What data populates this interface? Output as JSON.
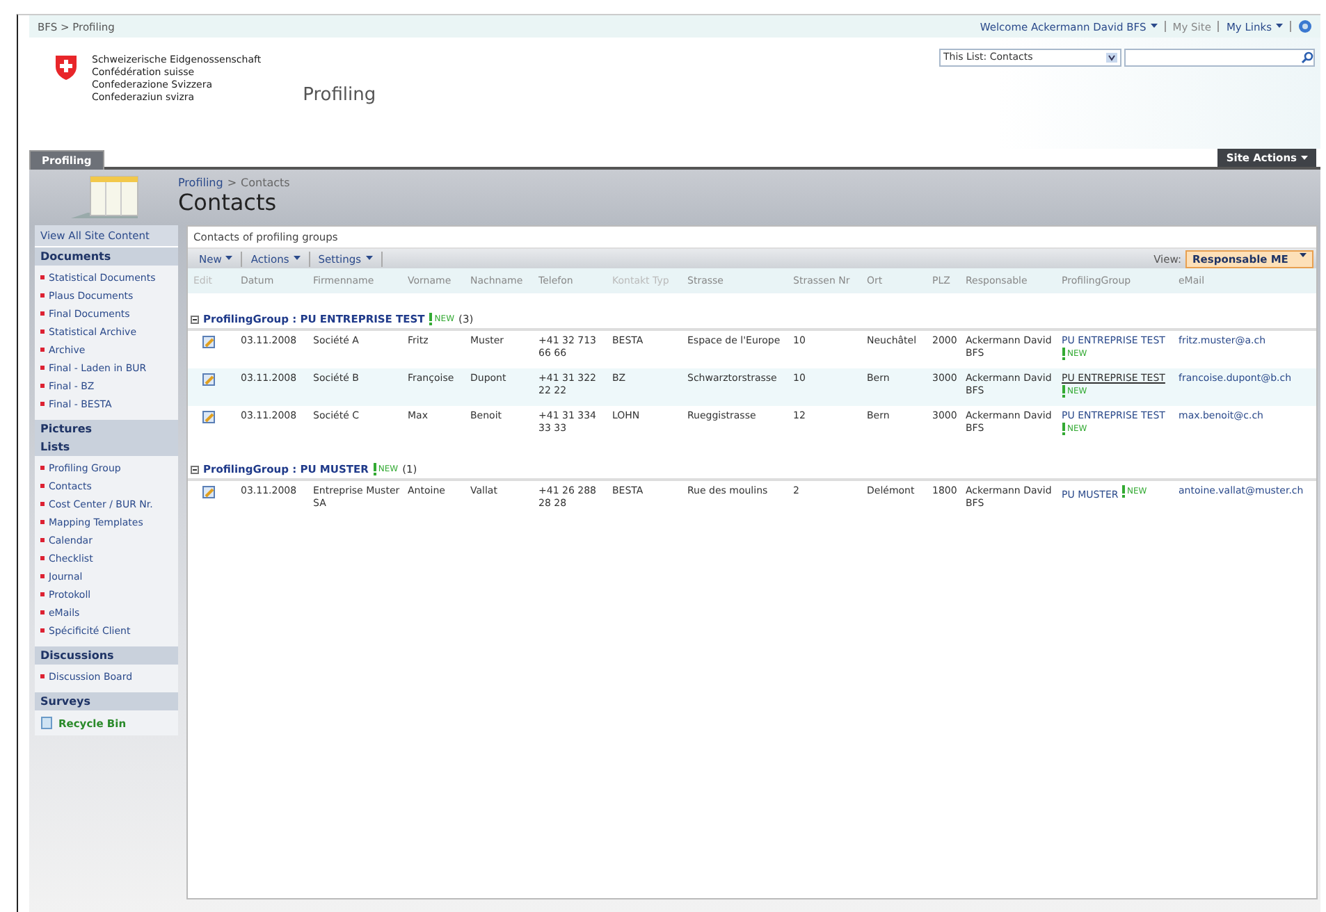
{
  "top_bar": {
    "breadcrumb": "BFS > Profiling",
    "welcome": "Welcome Ackermann David BFS",
    "my_site": "My Site",
    "my_links": "My Links"
  },
  "header": {
    "logo_lines": [
      "Schweizerische Eidgenossenschaft",
      "Confédération suisse",
      "Confederazione Svizzera",
      "Confederaziun svizra"
    ],
    "site_title": "Profiling",
    "search_scope": "This List: Contacts"
  },
  "tabs": [
    {
      "label": "Profiling",
      "selected": true
    }
  ],
  "site_actions": "Site Actions",
  "title_area": {
    "breadcrumb_link": "Profiling",
    "breadcrumb_sep": ">",
    "breadcrumb_current": "Contacts",
    "title": "Contacts"
  },
  "sidebar": {
    "view_all": "View All Site Content",
    "sections": [
      {
        "title": "Documents",
        "items": [
          "Statistical Documents",
          "Plaus Documents",
          "Final Documents",
          "Statistical Archive",
          "Archive",
          "Final - Laden in BUR",
          "Final - BZ",
          "Final - BESTA"
        ]
      },
      {
        "title": "Pictures"
      },
      {
        "title": "Lists",
        "items": [
          "Profiling Group",
          "Contacts",
          "Cost Center / BUR Nr.",
          "Mapping Templates",
          "Calendar",
          "Checklist",
          "Journal",
          "Protokoll",
          "eMails",
          "Spécificité Client"
        ]
      },
      {
        "title": "Discussions",
        "items": [
          "Discussion Board"
        ]
      },
      {
        "title": "Surveys"
      }
    ],
    "recycle_bin": "Recycle Bin"
  },
  "list": {
    "description": "Contacts of profiling groups",
    "toolbar": [
      "New",
      "Actions",
      "Settings"
    ],
    "view_label": "View:",
    "view": "Responsable ME",
    "columns": [
      "Edit",
      "Datum",
      "Firmenname",
      "Vorname",
      "Nachname",
      "Telefon",
      "Kontakt Typ",
      "Strasse",
      "Strassen Nr",
      "Ort",
      "PLZ",
      "Responsable",
      "ProfilingGroup",
      "eMail"
    ],
    "groups": [
      {
        "label": "ProfilingGroup :",
        "value": "PU ENTREPRISE TEST",
        "new_badge": "NEW",
        "count": "(3)",
        "expanded": true,
        "rows": [
          {
            "cells": [
              "03.11.2008",
              "Société A",
              "Fritz",
              "Muster",
              "+41 32 713 66 66",
              "BESTA",
              "Espace de l'Europe",
              "10",
              "Neuchâtel",
              "2000",
              "Ackermann David BFS"
            ],
            "group": "PU ENTREPRISE TEST",
            "new_badge": "NEW",
            "group_hovered": false,
            "email": "fritz.muster@a.ch"
          },
          {
            "cells": [
              "03.11.2008",
              "Société B",
              "Françoise",
              "Dupont",
              "+41 31 322 22 22",
              "BZ",
              "Schwarztorstrasse",
              "10",
              "Bern",
              "3000",
              "Ackermann David BFS"
            ],
            "group": "PU ENTREPRISE TEST",
            "new_badge": "NEW",
            "group_hovered": true,
            "email": "francoise.dupont@b.ch"
          },
          {
            "cells": [
              "03.11.2008",
              "Société C",
              "Max",
              "Benoit",
              "+41 31 334 33 33",
              "LOHN",
              "Rueggistrasse",
              "12",
              "Bern",
              "3000",
              "Ackermann David BFS"
            ],
            "group": "PU ENTREPRISE TEST",
            "new_badge": "NEW",
            "group_hovered": false,
            "email": "max.benoit@c.ch"
          }
        ]
      },
      {
        "label": "ProfilingGroup :",
        "value": "PU MUSTER",
        "new_badge": "NEW",
        "count": "(1)",
        "expanded": true,
        "rows": [
          {
            "cells": [
              "03.11.2008",
              "Entreprise Muster SA",
              "Antoine",
              "Vallat",
              "+41 26 288 28 28",
              "BESTA",
              "Rue des moulins",
              "2",
              "Delémont",
              "1800",
              "Ackermann David BFS"
            ],
            "group": "PU MUSTER",
            "new_badge": "NEW",
            "group_hovered": false,
            "email": "antoine.vallat@muster.ch"
          }
        ]
      }
    ]
  }
}
